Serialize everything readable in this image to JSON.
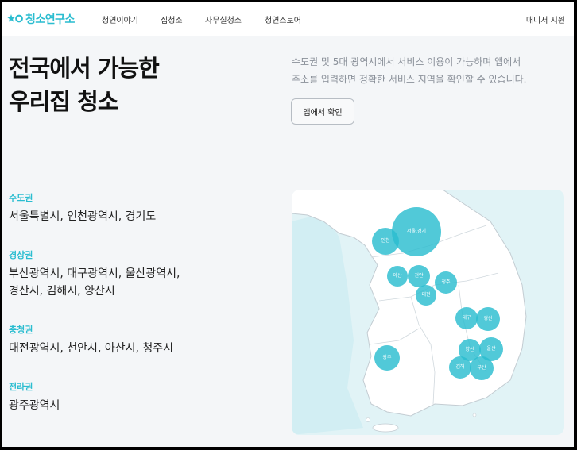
{
  "header": {
    "logo_text": "청소연구소",
    "nav": [
      "청연이야기",
      "집청소",
      "사무실청소",
      "청연스토어"
    ],
    "right_link": "매니저 지원"
  },
  "hero": {
    "title_line1": "전국에서 가능한",
    "title_line2": "우리집 청소",
    "desc_line1": "수도권 및 5대 광역시에서 서비스 이용이 가능하며 앱에서",
    "desc_line2": "주소를 입력하면 정확한 서비스 지역을 확인할 수 있습니다.",
    "button_label": "앱에서 확인"
  },
  "regions": [
    {
      "title": "수도권",
      "lines": [
        "서울특별시, 인천광역시, 경기도"
      ]
    },
    {
      "title": "경상권",
      "lines": [
        "부산광역시, 대구광역시, 울산광역시,",
        "경산시, 김해시, 양산시"
      ]
    },
    {
      "title": "충청권",
      "lines": [
        "대전광역시, 천안시, 아산시, 청주시"
      ]
    },
    {
      "title": "전라권",
      "lines": [
        "광주광역시"
      ]
    }
  ],
  "map": {
    "bubbles": [
      {
        "label": "서울,경기"
      },
      {
        "label": "인천"
      },
      {
        "label": "아산"
      },
      {
        "label": "천안"
      },
      {
        "label": "청주"
      },
      {
        "label": "대전"
      },
      {
        "label": "대구"
      },
      {
        "label": "경산"
      },
      {
        "label": "광주"
      },
      {
        "label": "양산"
      },
      {
        "label": "울산"
      },
      {
        "label": "김해"
      },
      {
        "label": "부산"
      }
    ],
    "colors": {
      "bubble": "#2bbdd0",
      "sea": "#e1f3f6",
      "land": "#ffffff",
      "border": "#c3ccd2"
    }
  },
  "theme": {
    "accent": "#2bbdd0",
    "background": "#f4f6f8"
  }
}
